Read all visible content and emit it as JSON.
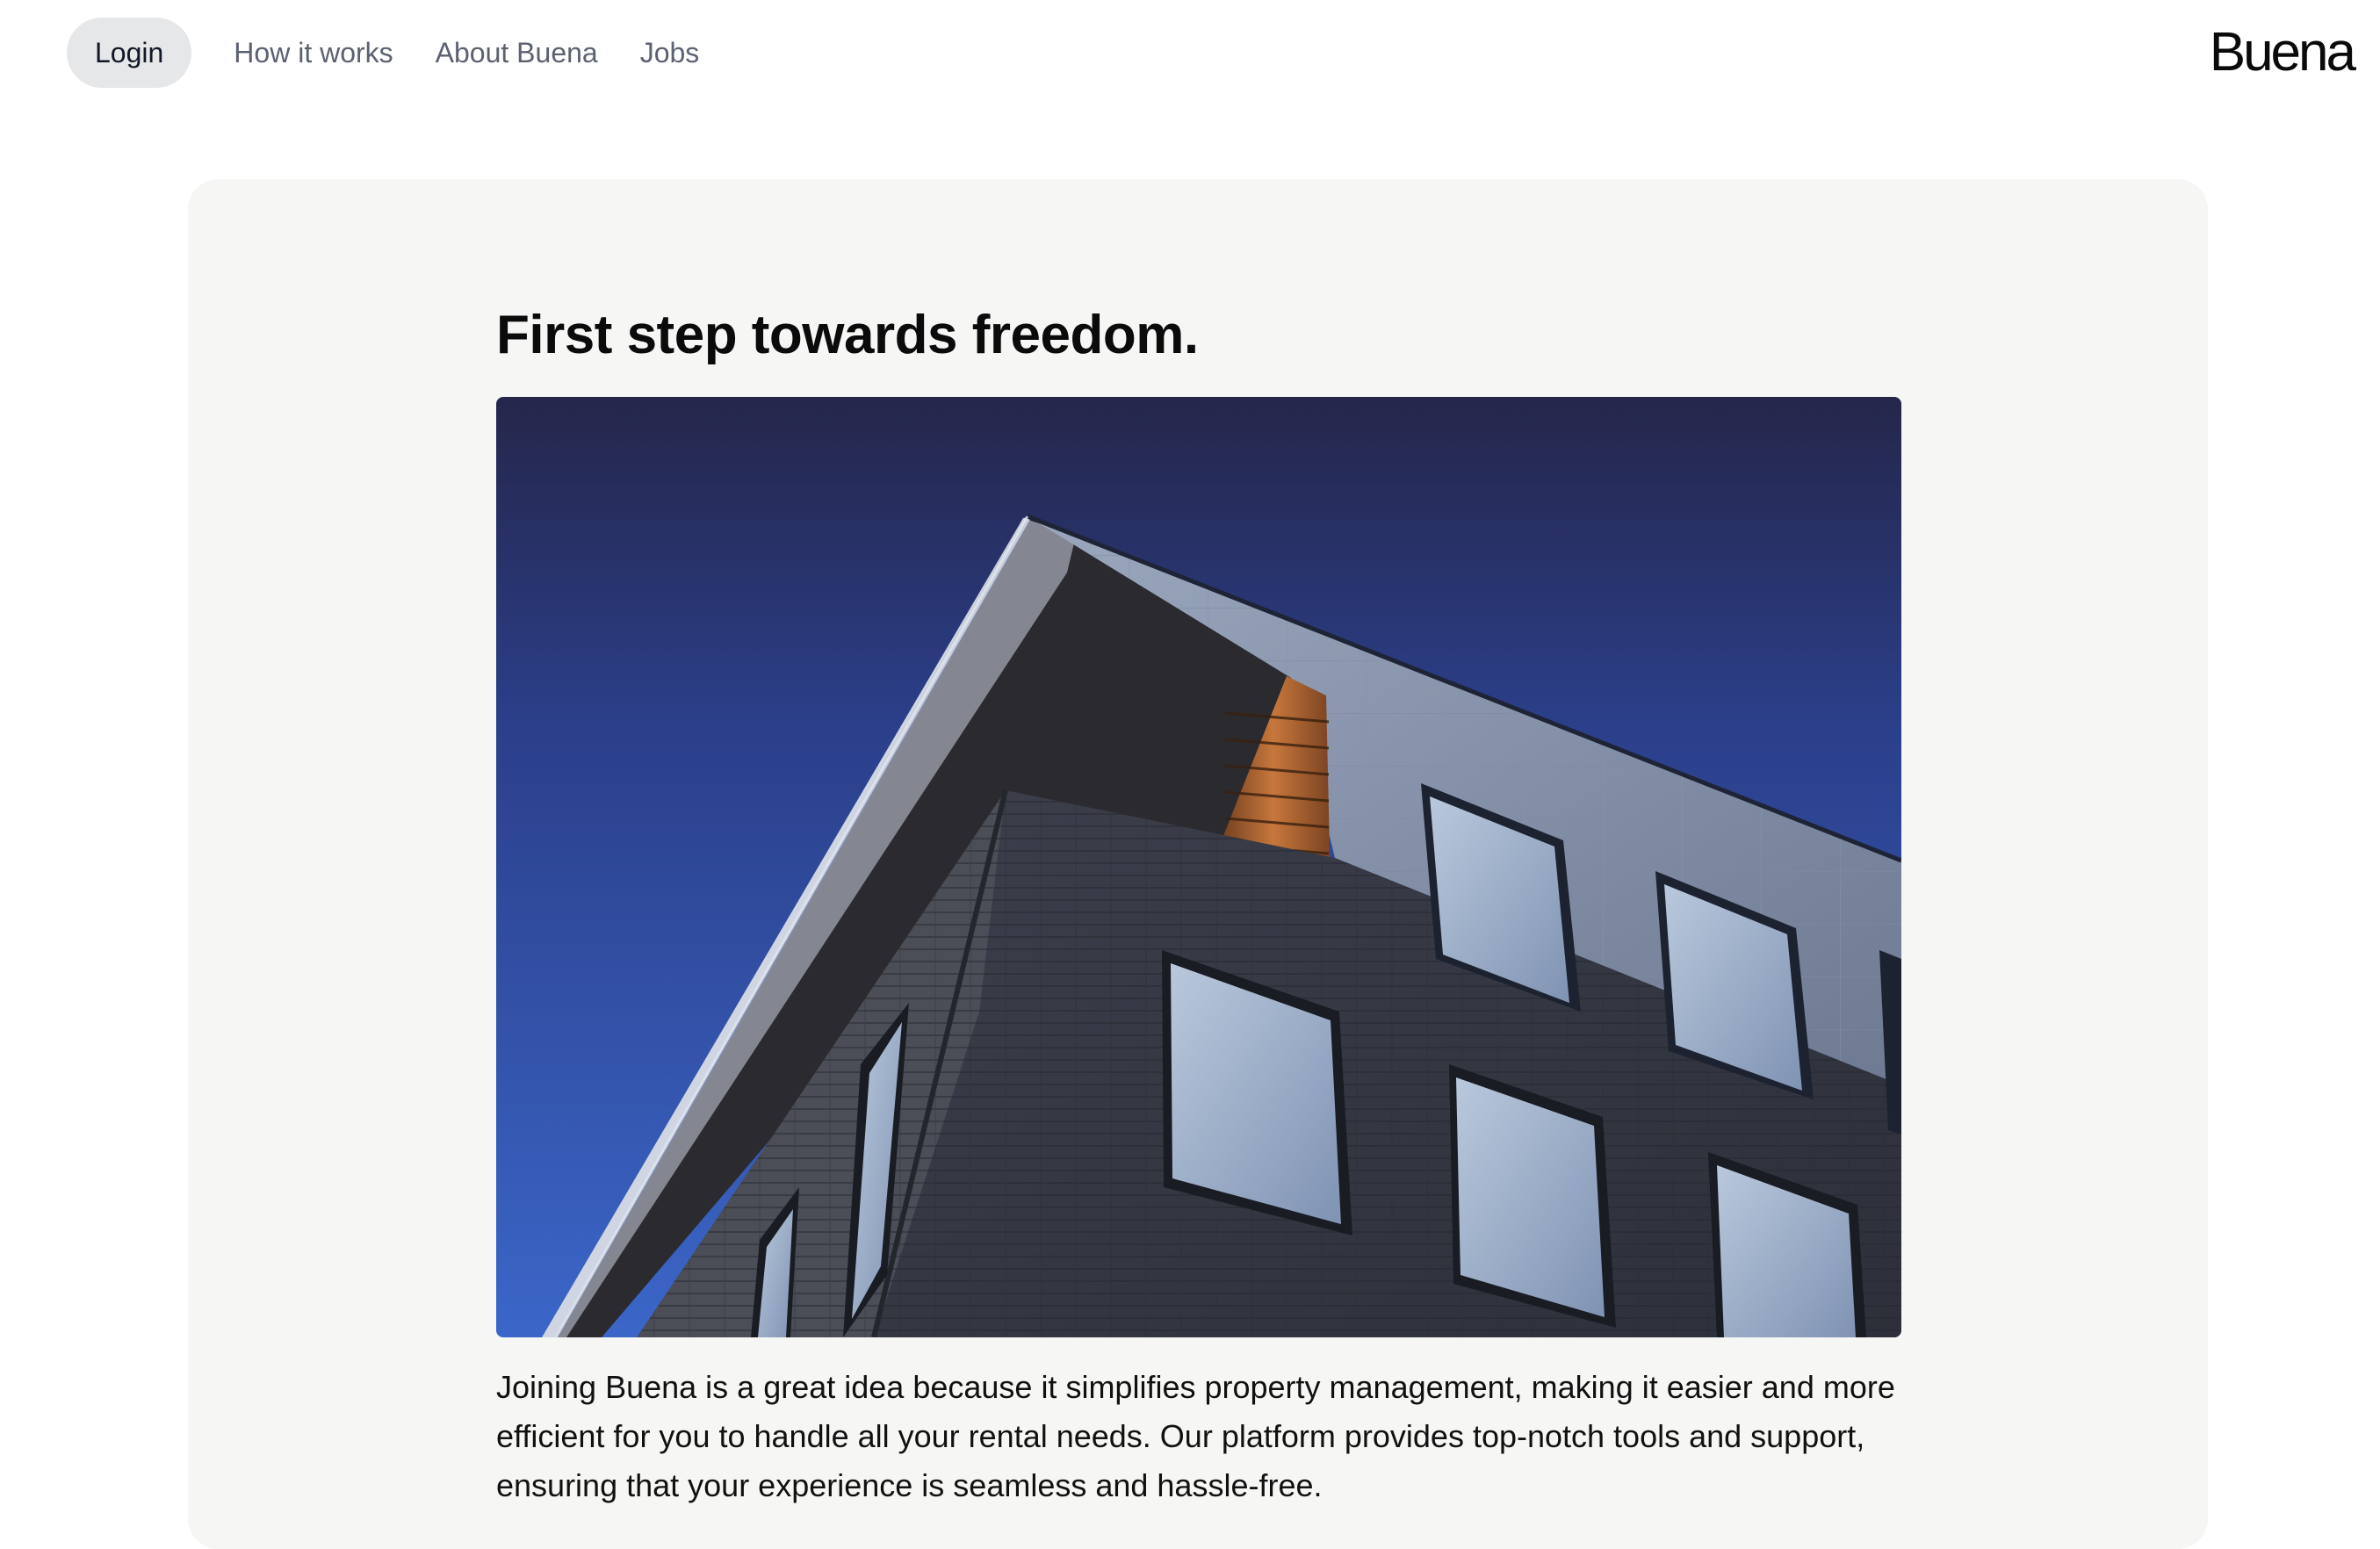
{
  "nav": {
    "login_label": "Login",
    "links": [
      "How it works",
      "About Buena",
      "Jobs"
    ]
  },
  "brand": {
    "logo_text": "Buena"
  },
  "hero": {
    "headline": "First step towards freedom.",
    "image_icon": "building-photo",
    "paragraph": "Joining Buena is a great idea because it simplifies property management, making it easier and more efficient for you to handle all your rental needs. Our platform provides top-notch tools and support, ensuring that your experience is seamless and hassle-free."
  },
  "colors": {
    "login_pill_bg": "#e6e7e9",
    "nav_link": "#5b6270",
    "card_bg": "#f6f6f4",
    "text": "#111111"
  }
}
